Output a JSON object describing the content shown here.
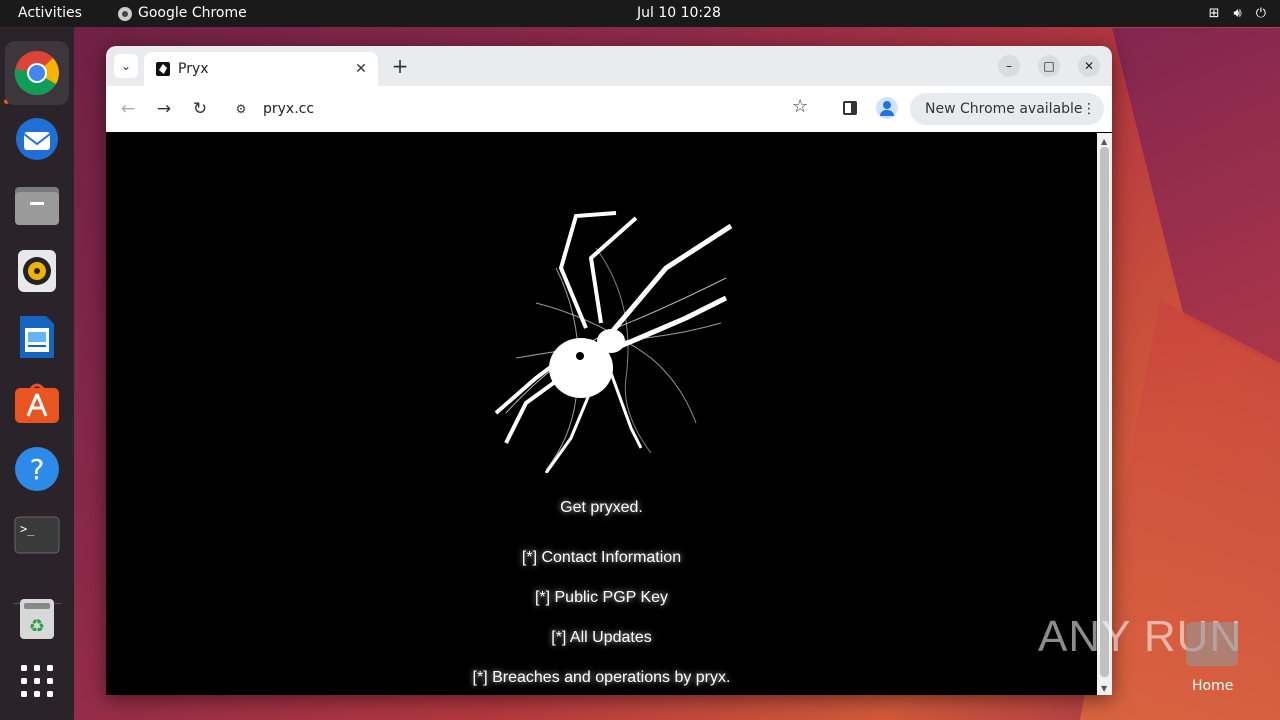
{
  "topbar": {
    "activities": "Activities",
    "app_name": "Google Chrome",
    "clock": "Jul 10  10:28"
  },
  "dock": {
    "apps": [
      "chrome-icon",
      "thunderbird-icon",
      "files-icon",
      "rhythmbox-icon",
      "writer-icon",
      "app-center-icon",
      "help-icon",
      "terminal-icon",
      "trash-icon",
      "show-apps-icon"
    ]
  },
  "browser": {
    "tab_title": "Pryx",
    "url": "pryx.cc",
    "update_chip": "New Chrome available"
  },
  "page": {
    "tagline": "Get pryxed.",
    "links": [
      "[*] Contact Information",
      "[*] Public PGP Key",
      "[*] All Updates",
      "[*] Breaches and operations by pryx."
    ]
  },
  "desktop": {
    "watermark": "ANY RUN",
    "home_label": "Home"
  },
  "colors": {
    "accent": "#e95420",
    "page_bg": "#000000",
    "text": "#ffffff"
  }
}
